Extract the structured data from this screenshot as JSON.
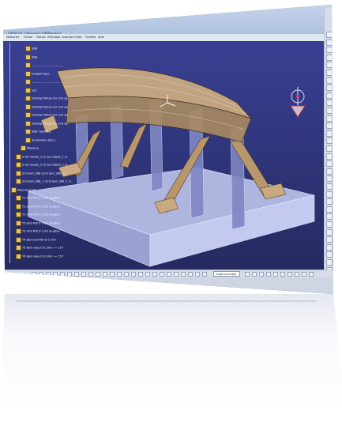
{
  "app": {
    "title": "CATIA V5 - [Process1.CATProcess]",
    "menu": [
      "Démarrer",
      "Fichier",
      "Édition",
      "Affichage",
      "Insertion",
      "Outils",
      "Fenêtre",
      "Aide"
    ]
  },
  "tree": {
    "nodes": [
      {
        "label": "SBB",
        "level": 3
      },
      {
        "label": "SBB",
        "level": 3
      },
      {
        "label": "...................................",
        "level": 3
      },
      {
        "label": "toolpath gen",
        "level": 3
      },
      {
        "label": "...................................",
        "level": 3
      },
      {
        "label": "uck",
        "level": 3
      },
      {
        "label": "holding fixture for 2nd op",
        "level": 3
      },
      {
        "label": "holding fixture for 2nd op",
        "level": 3
      },
      {
        "label": "holding fixture for 2nd op",
        "level": 3
      },
      {
        "label": "holding fixture for 2nd op",
        "level": 3
      },
      {
        "label": "SBB modified",
        "level": 3
      },
      {
        "label": "Annotation Set.1",
        "level": 3
      },
      {
        "label": "Measure",
        "level": 2
      },
      {
        "label": "2-op clipple_1 (2-op clipple_1.1)",
        "level": 1
      },
      {
        "label": "2-op clipple_2 (2-op clipple_2.1)",
        "level": 1
      },
      {
        "label": "2nd bed_388 (2nd bed_388_1)",
        "level": 1
      },
      {
        "label": "2nd bed_388_1 (2nd bed_388_1.1)",
        "level": 1
      },
      {
        "label": "ResourceList",
        "level": 0
      },
      {
        "label": "T1 End Mill D 1.00 rougher",
        "level": 1
      },
      {
        "label": "T2 End Mill D 1.00 rougher",
        "level": 1
      },
      {
        "label": "T2 End Mill D 1.00 rougher",
        "level": 1
      },
      {
        "label": "T3 End Mill D 1.00 rougher",
        "level": 1
      },
      {
        "label": "T3 End Mill D 1.00 rougher",
        "level": 1
      },
      {
        "label": "T4 Ball End Mill D 0.750",
        "level": 1
      },
      {
        "label": "T5 Bull nose D 0.300 r = 157",
        "level": 1
      },
      {
        "label": "T6 Bull nose D 0.300 r = 157",
        "level": 1
      }
    ]
  },
  "toolbar": {
    "layer_select": "Corps principal"
  },
  "colors": {
    "viewport_top": "#3a3f94",
    "viewport_bottom": "#262a60",
    "part_fill": "#c9a980",
    "base_fill": "#b9c0e6",
    "tree_text": "#f1f4ff"
  }
}
